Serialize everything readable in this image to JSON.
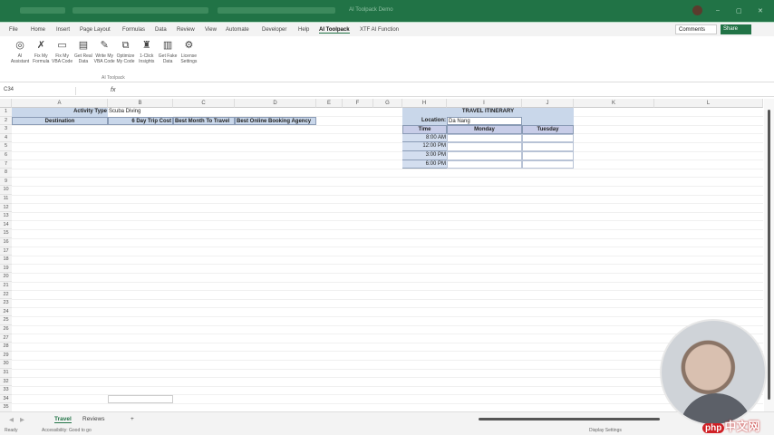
{
  "title_bar": {
    "document": "AI Toolpack Demo"
  },
  "menu": {
    "tabs": [
      "File",
      "Home",
      "Insert",
      "Page Layout",
      "Formulas",
      "Data",
      "Review",
      "View",
      "Automate",
      "Developer",
      "Help",
      "AI Toolpack",
      "XTF AI Function"
    ],
    "active": "AI Toolpack",
    "comments": "Comments",
    "share": "Share"
  },
  "ribbon": {
    "buttons": [
      {
        "label": "AI Assistant",
        "icon": "ai-assistant-icon"
      },
      {
        "label": "Fix My Formula",
        "icon": "fix-formula-icon"
      },
      {
        "label": "Fix My VBA Code",
        "icon": "vba-icon"
      },
      {
        "label": "Get Real Data",
        "icon": "real-data-icon"
      },
      {
        "label": "Write My VBA Code",
        "icon": "write-vba-icon"
      },
      {
        "label": "Optimize My Code",
        "icon": "optimize-icon"
      },
      {
        "label": "1-Click Insights",
        "icon": "robot-icon"
      },
      {
        "label": "Get Fake Data",
        "icon": "fake-data-icon"
      },
      {
        "label": "License Settings",
        "icon": "gear-icon"
      }
    ],
    "group_label": "AI Toolpack"
  },
  "formula_bar": {
    "name_box": "C34",
    "fx": "fx",
    "formula": ""
  },
  "sheet": {
    "columns": [
      "A",
      "B",
      "C",
      "D",
      "E",
      "F",
      "G",
      "H",
      "I",
      "J",
      "K",
      "L"
    ],
    "row_count": 35,
    "cells": {
      "A1": "Activity Type",
      "B1": "Scuba Diving",
      "A2": "Destination",
      "B2": "6 Day Trip Cost",
      "C2": "Best Month To Travel",
      "D2": "Best Online Booking Agency",
      "H1": "TRAVEL ITINERARY",
      "H2": "Location:",
      "I2": "Da Nang",
      "H3": "Time",
      "I3": "Monday",
      "J3": "Tuesday",
      "H4": "8:00 AM",
      "H5": "12:00 PM",
      "H6": "3:00 PM",
      "H7": "6:00 PM"
    }
  },
  "sheet_tabs": [
    "Travel",
    "Reviews"
  ],
  "active_sheet": "Travel",
  "add_sheet": "+",
  "status": {
    "ready": "Ready",
    "accessibility": "Accessibility: Good to go",
    "display": "Display Settings"
  },
  "watermark": {
    "brand": "php",
    "text": "中文网"
  }
}
